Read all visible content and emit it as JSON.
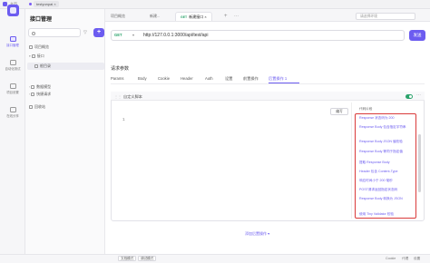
{
  "titlebar": {
    "home": "主页",
    "workspace": "testyunpai",
    "right_label": "",
    "right_time": ""
  },
  "rail": {
    "items": [
      {
        "label": "接口管理"
      },
      {
        "label": "自动化测试"
      },
      {
        "label": "项目设置"
      },
      {
        "label": "在线分享"
      }
    ]
  },
  "sidebar": {
    "title": "接口管理",
    "search_placeholder": "",
    "tree": [
      {
        "label": "项目概览"
      },
      {
        "label": "接口"
      },
      {
        "label": "根目录"
      },
      {
        "label": "数据模型"
      },
      {
        "label": "快捷请求"
      },
      {
        "label": "回收站"
      }
    ]
  },
  "tabs": [
    {
      "label": "项目概览",
      "method": ""
    },
    {
      "label": "新建...",
      "method": ""
    },
    {
      "label": "新建接口",
      "method": "GET"
    }
  ],
  "env_selector": {
    "label": "请选择环境"
  },
  "request": {
    "method": "GET",
    "url": "http://127.0.0.1:3000/api/test/api",
    "send_label": "发送"
  },
  "params": {
    "section_title": "请求参数",
    "tabs": [
      "Params",
      "Body",
      "Cookie",
      "Header",
      "Auth",
      "设置",
      "前置操作",
      "后置操作 1"
    ],
    "active_tab": "后置操作 1"
  },
  "script": {
    "title": "自定义脚本",
    "line_number": "1",
    "edit_button": "编写",
    "snippets_header": "代码片段",
    "snippets": [
      "Response 状态码为 200",
      "Response Body 包含指定字符串",
      "Response Body JSON 值校验",
      "Response Body 等同于指定值",
      "提取 Response Body",
      "Header 包含 Content-Type",
      "响应时间小于 200 毫秒",
      "POST请求返回指定状态码",
      "Response Body 转换为 JSON",
      "使用 Tiny Validator 校验"
    ],
    "add_post_label": "添加后置操作"
  },
  "statusbar": {
    "left_buttons": [
      "文档模式",
      "调试模式"
    ],
    "right_items": [
      "Cookie",
      "代理",
      "设置"
    ]
  }
}
